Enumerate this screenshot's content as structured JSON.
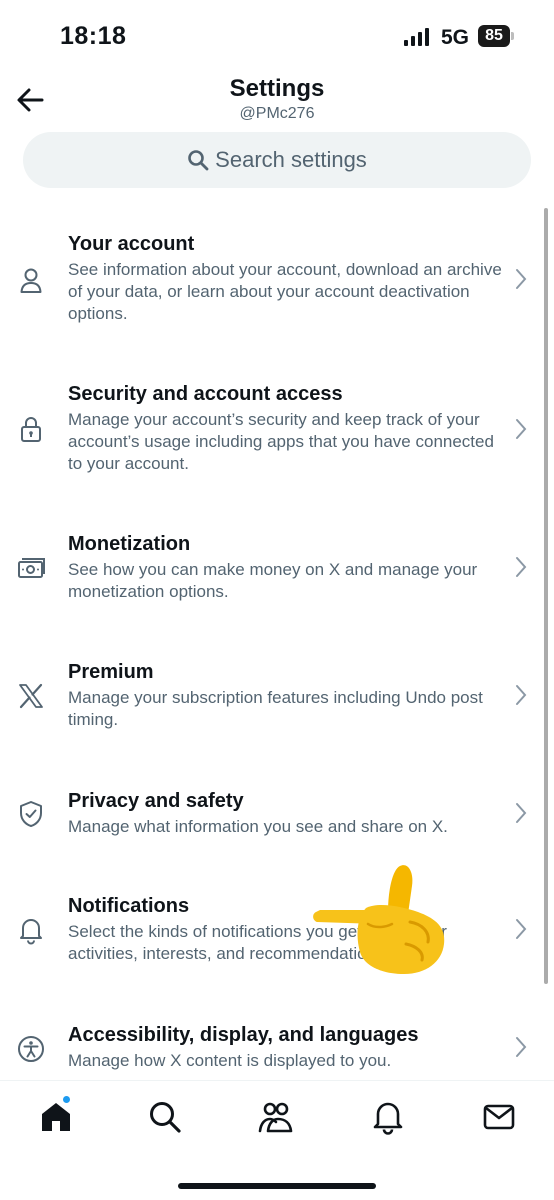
{
  "status": {
    "time": "18:18",
    "network": "5G",
    "battery": "85"
  },
  "header": {
    "title": "Settings",
    "handle": "@PMc276"
  },
  "search": {
    "placeholder": "Search settings"
  },
  "items": [
    {
      "title": "Your account",
      "description": "See information about your account, download an archive of your data, or learn about your account deactivation options.",
      "icon": "person-icon"
    },
    {
      "title": "Security and account access",
      "description": "Manage your account’s security and keep track of your account’s usage including apps that you have connected to your account.",
      "icon": "lock-icon"
    },
    {
      "title": "Monetization",
      "description": "See how you can make money on X and manage your monetization options.",
      "icon": "money-icon"
    },
    {
      "title": "Premium",
      "description": "Manage your subscription features including Undo post timing.",
      "icon": "x-logo-icon"
    },
    {
      "title": "Privacy and safety",
      "description": "Manage what information you see and share on X.",
      "icon": "shield-icon"
    },
    {
      "title": "Notifications",
      "description": "Select the kinds of notifications you get about your activities, interests, and recommendations.",
      "icon": "bell-icon"
    },
    {
      "title": "Accessibility, display, and languages",
      "description": "Manage how X content is displayed to you.",
      "icon": "accessibility-icon"
    }
  ],
  "tabs": [
    "home-icon",
    "search-icon",
    "communities-icon",
    "notifications-icon",
    "messages-icon"
  ],
  "colors": {
    "accent": "#1d9bf0",
    "text": "#0f1419",
    "secondary": "#536471",
    "search_bg": "#eff3f4"
  }
}
